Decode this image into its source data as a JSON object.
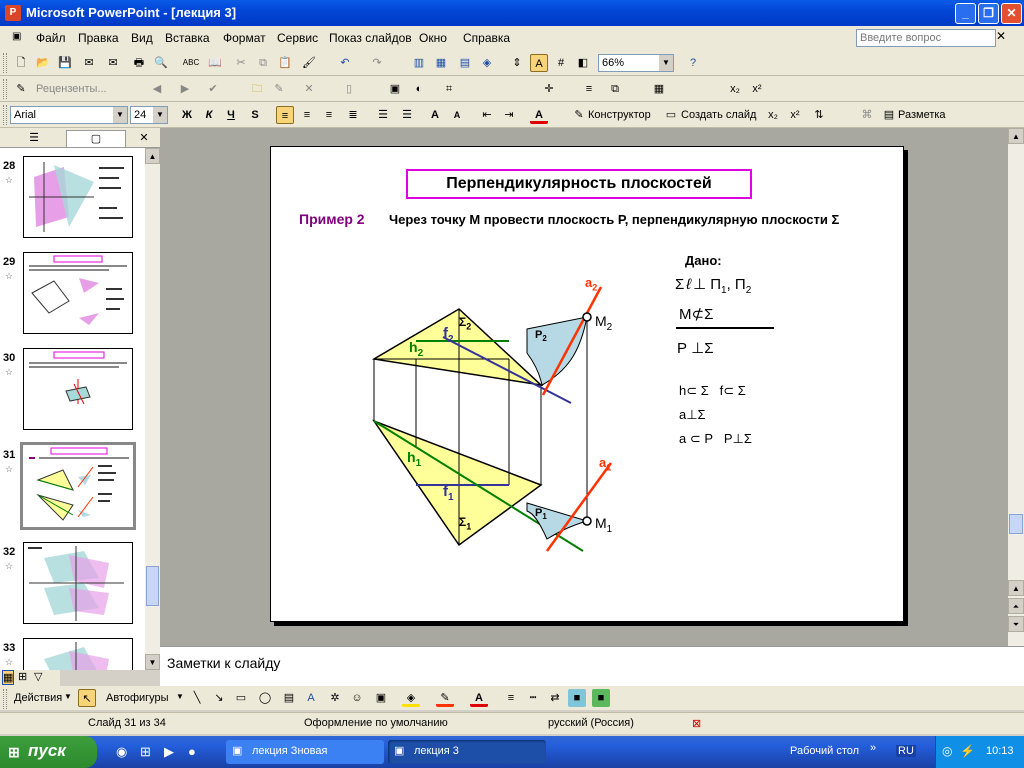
{
  "window": {
    "title": "Microsoft PowerPoint - [лекция 3]",
    "icon_letter": "P"
  },
  "menu": {
    "items": [
      "Файл",
      "Правка",
      "Вид",
      "Вставка",
      "Формат",
      "Сервис",
      "Показ слайдов",
      "Окно",
      "Справка"
    ],
    "ask_placeholder": "Введите вопрос"
  },
  "toolbar": {
    "zoom": "66%",
    "reviewers": "Рецензенты...",
    "font_name": "Arial",
    "font_size": "24",
    "bold": "Ж",
    "italic": "К",
    "underline": "Ч",
    "shadow": "S",
    "constructor": "Конструктор",
    "new_slide": "Создать слайд",
    "layout": "Разметка"
  },
  "slides": [
    {
      "number": "28"
    },
    {
      "number": "29"
    },
    {
      "number": "30"
    },
    {
      "number": "31",
      "selected": true
    },
    {
      "number": "32"
    },
    {
      "number": "33"
    }
  ],
  "slide": {
    "title": "Перпендикулярность плоскостей",
    "example_label": "Пример 2",
    "task_text": "Через точку М провести плоскость Р, перпендикулярную плоскости Σ",
    "given_label": "Дано:",
    "given": {
      "line1_a": "Σ",
      "line1_b": "ℓ",
      "line1_c": "⊥",
      "line1_d": "П",
      "line1_e": "1",
      "line1_f": ", П",
      "line1_g": "2",
      "line2_a": "М",
      "line2_b": "⊄",
      "line2_c": "Σ",
      "find": "Р ⊥Σ"
    },
    "solution": [
      "h⊂ Σ   f⊂ Σ",
      "a⊥Σ",
      "a ⊂ Р   Р⊥Σ"
    ],
    "labels": {
      "a2": "a",
      "a2s": "2",
      "a1": "a",
      "a1s": "1",
      "m2": "M",
      "m2s": "2",
      "m1": "M",
      "m1s": "1",
      "h2": "h",
      "h2s": "2",
      "f2": "f",
      "f2s": "2",
      "s2": "Σ",
      "s2s": "2",
      "h1": "h",
      "h1s": "1",
      "f1": "f",
      "f1s": "1",
      "s1": "Σ",
      "s1s": "1",
      "p2": "P",
      "p2s": "2",
      "p1": "P",
      "p1s": "1"
    },
    "colors": {
      "title_border": "#e100e1",
      "example": "#800080",
      "triangle_fill": "#ffff99",
      "green": "#008000",
      "navy": "#333399",
      "red": "#ff3300",
      "plane_fill": "#b7d9e5"
    }
  },
  "notes_placeholder": "Заметки к слайду",
  "drawing": {
    "actions": "Действия",
    "autoshapes": "Автофигуры"
  },
  "status": {
    "slide_counter": "Слайд 31 из 34",
    "design": "Оформление по умолчанию",
    "language": "русский (Россия)"
  },
  "taskbar": {
    "start": "пуск",
    "tasks": [
      "лекция Зновая",
      "лекция 3"
    ],
    "desktop": "Рабочий стол",
    "lang": "RU",
    "time": "10:13"
  }
}
